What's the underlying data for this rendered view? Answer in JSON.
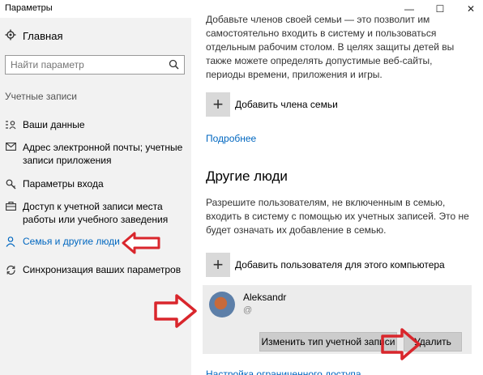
{
  "window": {
    "title": "Параметры",
    "minimize_glyph": "—",
    "maximize_glyph": "☐",
    "close_glyph": "✕"
  },
  "sidebar": {
    "home_label": "Главная",
    "search_placeholder": "Найти параметр",
    "section_header": "Учетные записи",
    "items": [
      {
        "label": "Ваши данные",
        "icon": "person-list-icon"
      },
      {
        "label": "Адрес электронной почты; учетные записи приложения",
        "icon": "mail-icon"
      },
      {
        "label": "Параметры входа",
        "icon": "key-icon"
      },
      {
        "label": "Доступ к учетной записи места работы или учебного заведения",
        "icon": "briefcase-icon"
      },
      {
        "label": "Семья и другие люди",
        "icon": "person-icon",
        "active": true
      },
      {
        "label": "Синхронизация ваших параметров",
        "icon": "sync-icon"
      }
    ]
  },
  "main": {
    "family_description": "Добавьте членов своей семьи — это позволит им самостоятельно входить в систему и пользоваться отдельным рабочим столом. В целях защиты детей вы также можете определять допустимые веб-сайты, периоды времени, приложения и игры.",
    "add_family_member": "Добавить члена семьи",
    "more_link": "Подробнее",
    "other_people_heading": "Другие люди",
    "other_people_description": "Разрешите пользователям, не включенным в семью, входить в систему с помощью их учетных записей. Это не будет означать их добавление в семью.",
    "add_user": "Добавить пользователя для этого компьютера",
    "user": {
      "name": "Aleksandr",
      "email_visible": "@"
    },
    "change_account_type_button": "Изменить тип учетной записи",
    "delete_button": "Удалить",
    "bottom_link": "Настройка ограниченного доступа"
  },
  "colors": {
    "accent": "#0067c0",
    "annotation_arrow": "#d9262c",
    "sidebar_bg": "#f2f2f2"
  }
}
